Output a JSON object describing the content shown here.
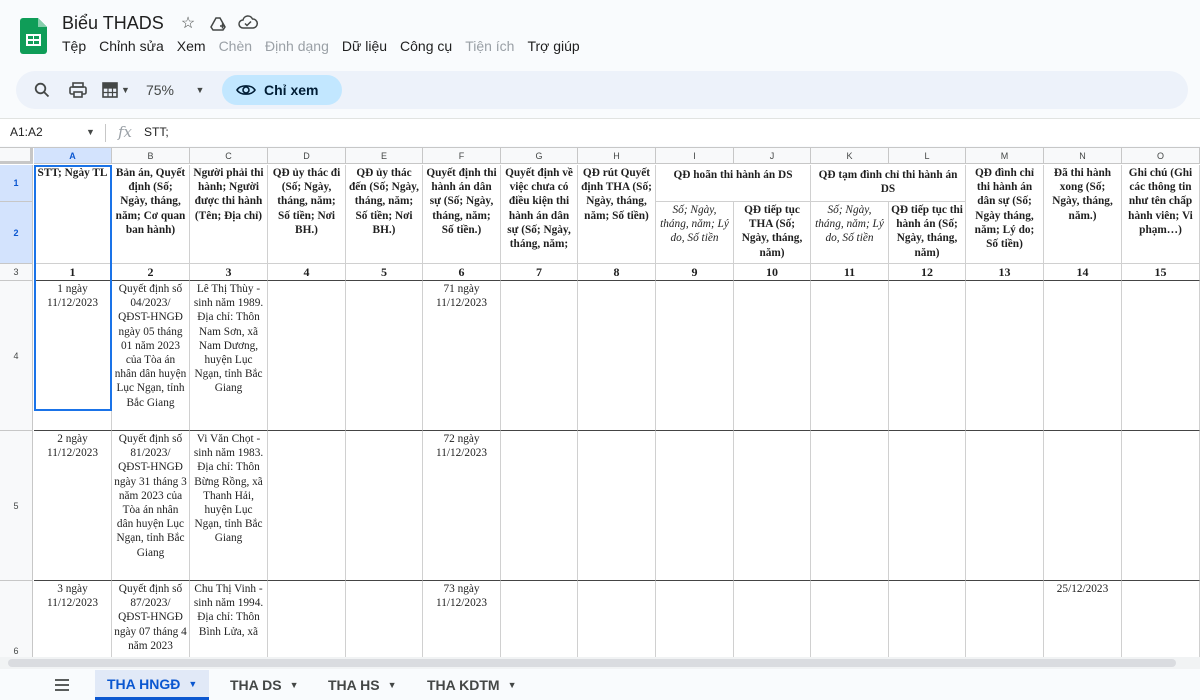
{
  "doc": {
    "title": "Biểu THADS"
  },
  "menu": [
    "Tệp",
    "Chỉnh sửa",
    "Xem",
    "Chèn",
    "Định dạng",
    "Dữ liệu",
    "Công cụ",
    "Tiện ích",
    "Trợ giúp"
  ],
  "menu_disabled": [
    false,
    false,
    false,
    true,
    true,
    false,
    false,
    true,
    false
  ],
  "toolbar": {
    "zoom": "75%",
    "view_only_label": "Chỉ xem"
  },
  "formula_bar": {
    "name_box": "A1:A2",
    "fx": "fx",
    "content": "STT;"
  },
  "columns": [
    "A",
    "B",
    "C",
    "D",
    "E",
    "F",
    "G",
    "H",
    "I",
    "J",
    "K",
    "L",
    "M",
    "N",
    "O"
  ],
  "row_numbers": [
    "1",
    "2",
    "3",
    "4",
    "5",
    "6"
  ],
  "headers": {
    "A": "STT; Ngày TL",
    "B": "Bản án, Quyết định (Số; Ngày, tháng, năm; Cơ quan ban hành)",
    "C": "Người phải thi hành; Người được thi hành (Tên; Địa chỉ)",
    "D": "QĐ ủy thác đi (Số; Ngày, tháng, năm; Số tiền; Nơi BH.)",
    "E": "QĐ ủy thác đến (Số; Ngày, tháng, năm; Số tiền; Nơi BH.)",
    "F": "Quyết định thi hành án dân sự (Số; Ngày, tháng, năm; Số tiền.)",
    "G": "Quyết định về việc chưa có điều kiện thi hành án dân sự (Số; Ngày, tháng, năm;",
    "H": "QĐ rút Quyết định THA (Số; Ngày, tháng, năm; Số tiền)",
    "IJ": "QĐ hoãn thi hành án DS",
    "I2": "Số; Ngày, tháng, năm; Lý do, Số tiền",
    "J2": "QĐ tiếp tục THA (Số; Ngày, tháng, năm)",
    "KL": "QĐ tạm đình chỉ thi hành án DS",
    "K2": "Số; Ngày, tháng, năm; Lý do, Số tiền",
    "L2": "QĐ tiếp tục thi hành án (Số; Ngày, tháng, năm)",
    "M": "QĐ đình chỉ thi hành án dân sự (Số; Ngày tháng, năm; Lý do; Số tiền)",
    "N": "Đã thi hành xong (Số; Ngày, tháng, năm.)",
    "O": "Ghi chú (Ghi các thông tin như tên chấp hành viên; Vi phạm…)"
  },
  "col_numbers": [
    "1",
    "2",
    "3",
    "4",
    "5",
    "6",
    "7",
    "8",
    "9",
    "10",
    "11",
    "12",
    "13",
    "14",
    "15"
  ],
  "rows": [
    {
      "A": "1 ngày 11/12/2023",
      "B": "Quyết định số 04/2023/ QĐST-HNGĐ ngày 05 tháng 01 năm 2023 của Tòa án nhân dân huyện Lục Ngạn, tỉnh Bắc Giang",
      "C": "Lê Thị Thùy - sinh năm 1989. Địa chỉ: Thôn Nam Sơn, xã Nam Dương, huyện Lục Ngạn, tỉnh Bắc Giang",
      "F": "71 ngày 11/12/2023",
      "N": ""
    },
    {
      "A": "2 ngày 11/12/2023",
      "B": "Quyết định số 81/2023/ QĐST-HNGĐ ngày 31 tháng 3 năm 2023 của Tòa án nhân dân huyện Lục Ngạn, tỉnh Bắc Giang",
      "C": "Vi Văn Chọt - sinh năm 1983. Địa chỉ: Thôn Bừng Rồng, xã Thanh Hải, huyện Lục Ngạn, tỉnh Bắc Giang",
      "F": "72 ngày 11/12/2023",
      "N": ""
    },
    {
      "A": "3 ngày 11/12/2023",
      "B": "Quyết định số 87/2023/ QĐST-HNGĐ ngày 07 tháng 4 năm 2023",
      "C": "Chu Thị Vinh - sinh năm 1994. Địa chỉ: Thôn Bình Lửa, xã",
      "F": "73 ngày 11/12/2023",
      "N": "25/12/2023"
    }
  ],
  "sheets": [
    {
      "label": "THA HNGĐ",
      "active": true
    },
    {
      "label": "THA DS",
      "active": false
    },
    {
      "label": "THA HS",
      "active": false
    },
    {
      "label": "THA KDTM",
      "active": false
    }
  ],
  "colors": {
    "accent": "#0b57d0",
    "view_only_bg": "#c2e7ff",
    "sheets_green": "#0f9d58",
    "selection": "#1a73e8"
  }
}
